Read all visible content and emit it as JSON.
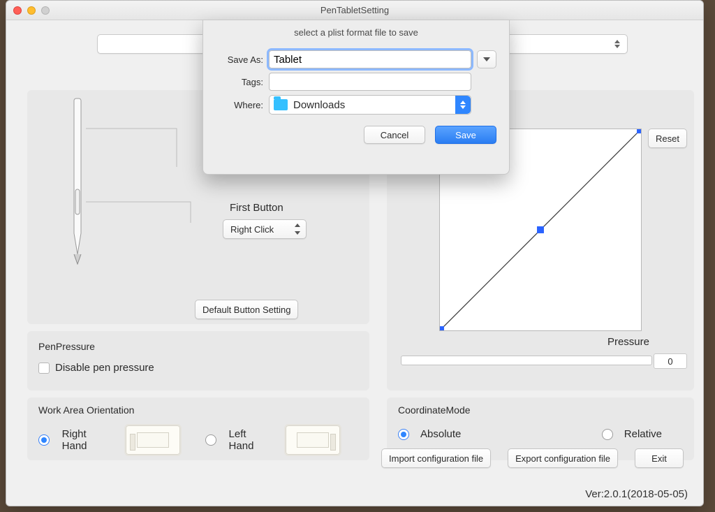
{
  "window": {
    "title": "PenTabletSetting"
  },
  "pen": {
    "first_button_label": "First Button",
    "first_button_value": "Right Click",
    "default_button": "Default  Button Setting"
  },
  "pen_pressure": {
    "heading": "PenPressure",
    "disable_label": "Disable pen pressure"
  },
  "orientation": {
    "heading": "Work Area Orientation",
    "right_label": "Right Hand",
    "left_label": "Left Hand",
    "selected": "right"
  },
  "curve": {
    "reset": "Reset",
    "axis_label": "Pressure",
    "value": "0"
  },
  "coord": {
    "heading": "CoordinateMode",
    "absolute": "Absolute",
    "relative": "Relative",
    "selected": "absolute"
  },
  "footer": {
    "import": "Import configuration file",
    "export": "Export configuration file",
    "exit": "Exit",
    "version": "Ver:2.0.1(2018-05-05)"
  },
  "save_dialog": {
    "message": "select a plist format file to save",
    "save_as_label": "Save As:",
    "save_as_value": "Tablet",
    "tags_label": "Tags:",
    "tags_value": "",
    "where_label": "Where:",
    "where_value": "Downloads",
    "cancel": "Cancel",
    "save": "Save"
  }
}
